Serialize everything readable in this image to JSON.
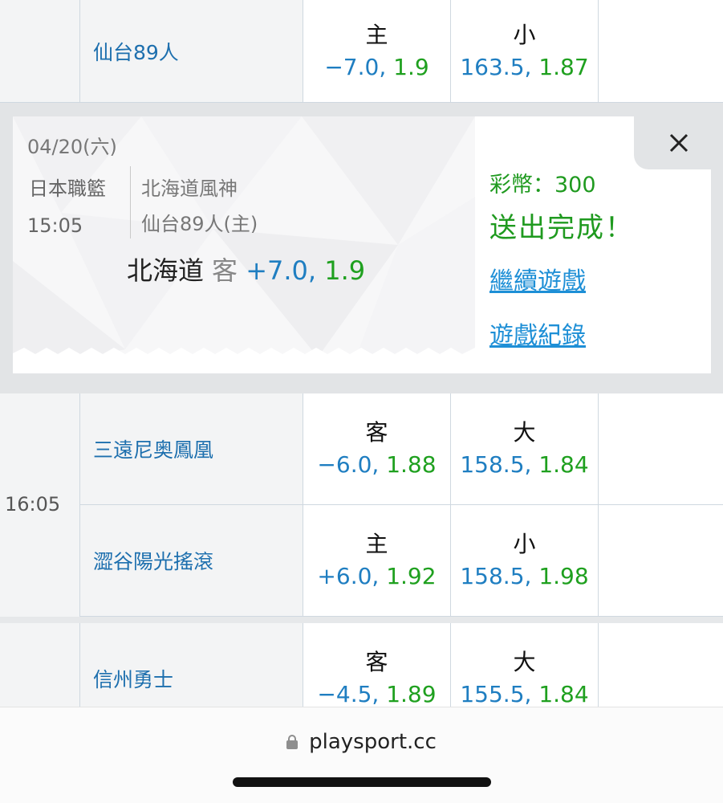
{
  "rows": {
    "top": {
      "team": "仙台89人",
      "spread_side": "主",
      "spread_line": "−7.0,",
      "spread_odds": "1.9",
      "total_side": "小",
      "total_line": "163.5,",
      "total_odds": "1.87"
    },
    "m2a": {
      "team": "三遠尼奥鳳凰",
      "spread_side": "客",
      "spread_line": "−6.0,",
      "spread_odds": "1.88",
      "total_side": "大",
      "total_line": "158.5,",
      "total_odds": "1.84"
    },
    "m2b": {
      "team": "澀谷陽光搖滾",
      "spread_side": "主",
      "spread_line": "+6.0,",
      "spread_odds": "1.92",
      "total_side": "小",
      "total_line": "158.5,",
      "total_odds": "1.98"
    },
    "m2_time": "16:05",
    "m3a": {
      "team": "信州勇士",
      "spread_side": "客",
      "spread_line": "−4.5,",
      "spread_odds": "1.89",
      "total_side": "大",
      "total_line": "155.5,",
      "total_odds": "1.84"
    }
  },
  "ticket": {
    "date": "04/20(六)",
    "league": "日本職籃",
    "time": "15:05",
    "team1": "北海道風神",
    "team2": "仙台89人(主)",
    "pick_team": "北海道",
    "pick_side": "客",
    "pick_line": "+7.0,",
    "pick_odds": "1.9"
  },
  "result": {
    "coins": "彩幣：300",
    "done": "送出完成！",
    "continue_link": "繼續遊戲",
    "history_link": "遊戲紀錄"
  },
  "browser": {
    "url": "playsport.cc"
  },
  "colors": {
    "team_blue": "#1d6fae",
    "line_blue": "#1f7ec1",
    "odds_green": "#1fa01f",
    "link_blue": "#1e8fd6"
  }
}
